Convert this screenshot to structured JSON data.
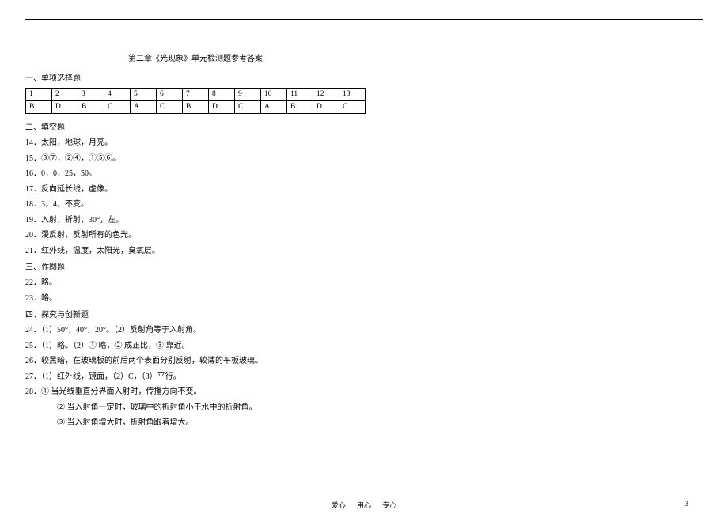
{
  "title": "第二章《光现象》单元检测题参考答案",
  "section1_heading": "一、单项选择题",
  "table": {
    "header": [
      "1",
      "2",
      "3",
      "4",
      "5",
      "6",
      "7",
      "8",
      "9",
      "10",
      "11",
      "12",
      "13"
    ],
    "answers": [
      "B",
      "D",
      "B",
      "C",
      "A",
      "C",
      "B",
      "D",
      "C",
      "A",
      "B",
      "D",
      "C"
    ]
  },
  "section2_heading": "二、填空题",
  "fill_lines": [
    "14．太阳，地球，月亮。",
    "15．③⑦，②④，①⑤⑥。",
    "16．0，0，25，50。",
    "17．反向延长线，虚像。",
    "18．3，4，不变。",
    "19．入射，折射，30°，左。",
    "20．漫反射，反射所有的色光。",
    "21．红外线，温度，太阳光，臭氧层。"
  ],
  "section3_heading": "三、作图题",
  "drawing_lines": [
    "22．略。",
    "23．略。"
  ],
  "section4_heading": "四、探究与创新题",
  "explore_lines": [
    "24．（1）50°，40°，20°。（2）反射角等于入射角。",
    "25．（1）略。（2）① 略，② 成正比，③ 靠近。",
    "26．较黑暗，在玻璃板的前后两个表面分别反射，较薄的平板玻璃。",
    "27．（1）红外线，镜面，（2）C，（3）平行。",
    "28．① 当光线垂直分界面入射时，传播方向不变。"
  ],
  "explore_indented": [
    "② 当入射角一定时，玻璃中的折射角小于水中的折射角。",
    "③ 当入射角增大时，折射角跟着增大。"
  ],
  "footer": {
    "w1": "爱心",
    "w2": "用心",
    "w3": "专心",
    "page": "3"
  }
}
